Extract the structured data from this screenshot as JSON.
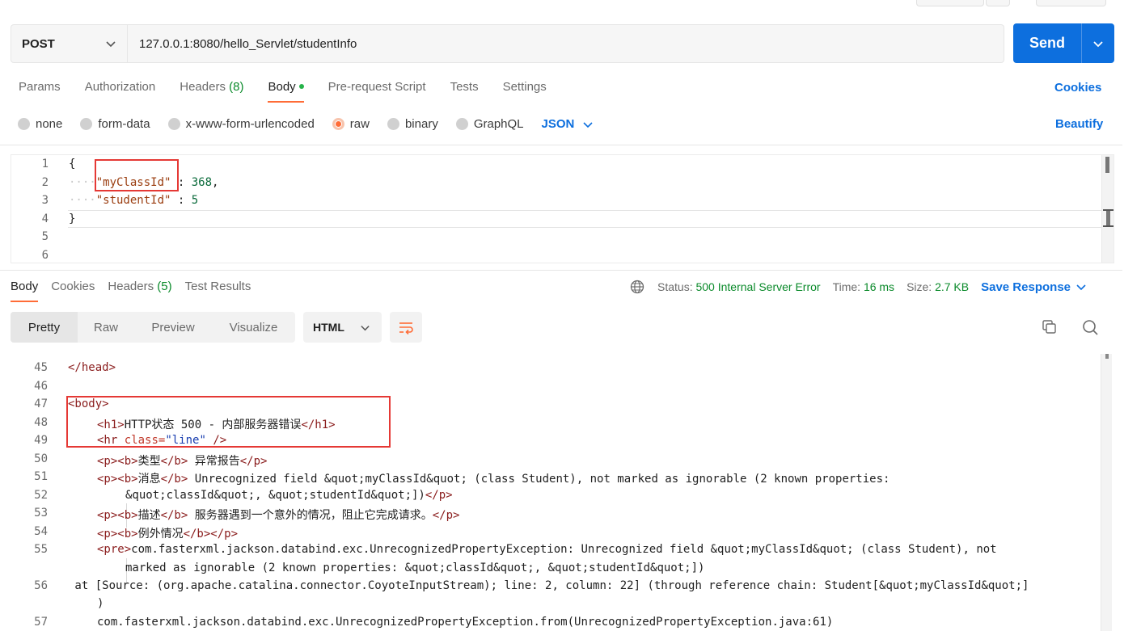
{
  "request": {
    "method": "POST",
    "url": "127.0.0.1:8080/hello_Servlet/studentInfo",
    "send_label": "Send",
    "tabs": [
      {
        "label": "Params"
      },
      {
        "label": "Authorization"
      },
      {
        "label": "Headers",
        "count": "(8)"
      },
      {
        "label": "Body"
      },
      {
        "label": "Pre-request Script"
      },
      {
        "label": "Tests"
      },
      {
        "label": "Settings"
      }
    ],
    "cookies_label": "Cookies",
    "body_types": [
      "none",
      "form-data",
      "x-www-form-urlencoded",
      "raw",
      "binary",
      "GraphQL"
    ],
    "selected_body_type": "raw",
    "language": "JSON",
    "beautify_label": "Beautify",
    "editor": {
      "line_numbers": [
        "1",
        "2",
        "3",
        "4",
        "5",
        "6"
      ],
      "open_brace": "{",
      "key1": "\"myClassId\"",
      "colon1": " : ",
      "val1": "368",
      "comma": ",",
      "key2": "\"studentId\"",
      "colon2": " : ",
      "val2": "5",
      "close_brace": "}",
      "indent": "····",
      "ws": "·"
    }
  },
  "response": {
    "tabs": [
      {
        "label": "Body"
      },
      {
        "label": "Cookies"
      },
      {
        "label": "Headers",
        "count": "(5)"
      },
      {
        "label": "Test Results"
      }
    ],
    "status_label": "Status:",
    "status_value": "500 Internal Server Error",
    "time_label": "Time:",
    "time_value": "16 ms",
    "size_label": "Size:",
    "size_value": "2.7 KB",
    "save_label": "Save Response",
    "view_modes": [
      "Pretty",
      "Raw",
      "Preview",
      "Visualize"
    ],
    "format": "HTML",
    "lines": {
      "n45": "45",
      "n46": "46",
      "n47": "47",
      "n48": "48",
      "n49": "49",
      "n50": "50",
      "n51": "51",
      "n52": "52",
      "n53": "53",
      "n54": "54",
      "n55": "55",
      "n56": "56",
      "n57": "57",
      "l45": "</head>",
      "l47": "<body>",
      "l48_open": "<h1>",
      "l48_text": "HTTP状态 500 - 内部服务器错误",
      "l48_close": "</h1>",
      "l49_tag": "<hr",
      "l49_attr": " class=",
      "l49_val": "\"line\"",
      "l49_end": " />",
      "l50_a": "<p><b>",
      "l50_b": "类型",
      "l50_c": "</b>",
      "l50_d": " 异常报告",
      "l50_e": "</p>",
      "l51_a": "<p><b>",
      "l51_b": "消息",
      "l51_c": "</b>",
      "l51_d": " Unrecognized field &quot;myClassId&quot; (class Student), not marked as ignorable (2 known properties:",
      "l51_cont": "&quot;classId&quot;, &quot;studentId&quot;])",
      "l51_close": "</p>",
      "l53_a": "<p><b>",
      "l53_b": "描述",
      "l53_c": "</b>",
      "l53_d": " 服务器遇到一个意外的情况，阻止它完成请求。",
      "l53_e": "</p>",
      "l54_a": "<p><b>",
      "l54_b": "例外情况",
      "l54_c": "</b></p>",
      "l55_a": "<pre>",
      "l55_b": "com.fasterxml.jackson.databind.exc.UnrecognizedPropertyException: Unrecognized field &quot;myClassId&quot; (class Student), not",
      "l55_cont": "marked as ignorable (2 known properties: &quot;classId&quot;, &quot;studentId&quot;])",
      "l56": " at [Source: (org.apache.catalina.connector.CoyoteInputStream); line: 2, column: 22] (through reference chain: Student[&quot;myClassId&quot;]",
      "l56_cont": ")",
      "l57": "com.fasterxml.jackson.databind.exc.UnrecognizedPropertyException.from(UnrecognizedPropertyException.java:61)"
    }
  }
}
